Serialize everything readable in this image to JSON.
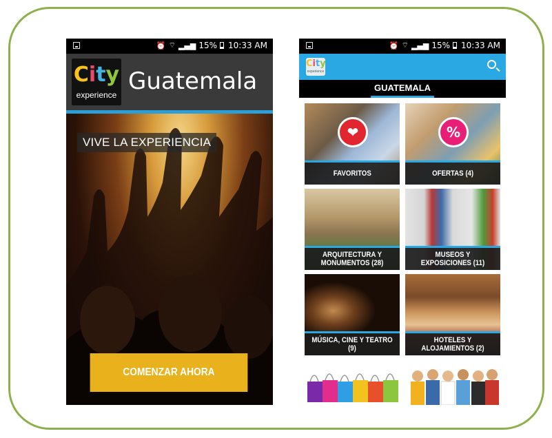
{
  "status_bar": {
    "icons_right": [
      "alarm-icon",
      "wifi-icon",
      "signal-icon"
    ],
    "battery": "15%",
    "time": "10:33 AM"
  },
  "splash": {
    "logo": {
      "word": "City",
      "sub": "experience"
    },
    "title": "Guatemala",
    "tagline": "VIVE LA EXPERIENCIA",
    "cta_label": "COMENZAR AHORA"
  },
  "home": {
    "logo": {
      "word": "City",
      "sub": "experience"
    },
    "city_tab": "GUATEMALA",
    "tiles": [
      {
        "label": "FAVORITOS",
        "badge": "❤"
      },
      {
        "label": "OFERTAS (4)",
        "badge": "%"
      },
      {
        "label": "ARQUITECTURA Y MONUMENTOS (28)"
      },
      {
        "label": "MUSEOS Y EXPOSICIONES (11)"
      },
      {
        "label": "MÚSICA, CINE Y TEATRO (9)"
      },
      {
        "label": "HOTELES Y ALOJAMIENTOS (2)"
      }
    ]
  },
  "colors": {
    "frame": "#8db04c",
    "accent_blue": "#29a8e3",
    "cta_yellow": "#e9b21c",
    "favorites_red": "#e2262f",
    "offers_pink": "#e91e76"
  }
}
